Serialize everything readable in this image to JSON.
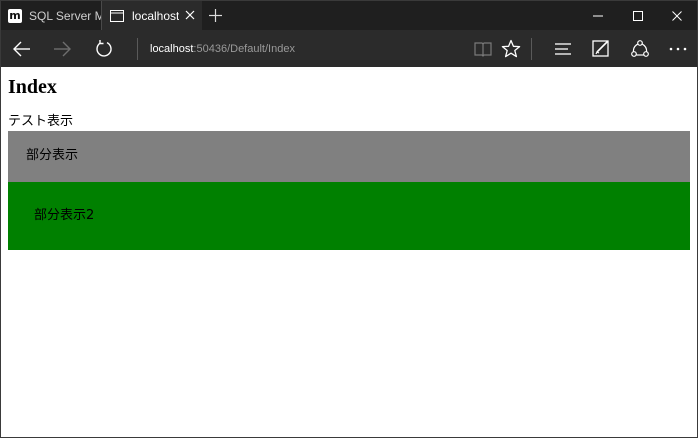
{
  "browser": {
    "tabs": [
      {
        "label": "SQL Server M",
        "icon": "m-icon",
        "active": false
      },
      {
        "label": "localhost",
        "icon": "page-icon",
        "active": true
      }
    ],
    "address": {
      "host": "localhost",
      "path": ":50436/Default/Index"
    },
    "window_controls": [
      "minimize-icon",
      "maximize-icon",
      "close-icon"
    ],
    "toolbar_icons": [
      "back-icon",
      "forward-icon",
      "refresh-icon",
      "reading-view-icon",
      "favorite-star-icon",
      "hub-icon",
      "web-note-icon",
      "share-icon",
      "more-icon"
    ],
    "colors": {
      "tabbar_bg": "#1f1f1f",
      "navbar_bg": "#2b2b2b"
    }
  },
  "page": {
    "title": "Index",
    "intro": "テスト表示",
    "partial1": {
      "text": "部分表示",
      "bg": "#808080"
    },
    "partial2": {
      "text": "部分表示2",
      "bg": "#008000"
    }
  }
}
